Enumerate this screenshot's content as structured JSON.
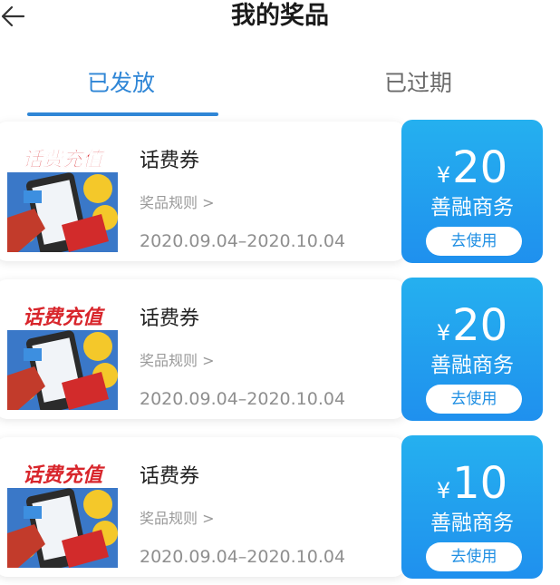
{
  "header": {
    "title": "我的奖品",
    "back_icon": "arrow-left-icon"
  },
  "tabs": [
    {
      "label": "已发放",
      "active": true
    },
    {
      "label": "已过期",
      "active": false
    }
  ],
  "colors": {
    "accent": "#2f86d6",
    "coupon_blue": "#1f90ee",
    "coupon_blue_light": "#25b0ef"
  },
  "coupons": [
    {
      "image_text": "话费充值",
      "name": "话费券",
      "rules_link": "奖品规则 >",
      "dates": "2020.09.04–2020.10.04",
      "currency": "¥",
      "amount": "20",
      "merchant": "善融商务",
      "button": "去使用"
    },
    {
      "image_text": "话费充值",
      "name": "话费券",
      "rules_link": "奖品规则 >",
      "dates": "2020.09.04–2020.10.04",
      "currency": "¥",
      "amount": "20",
      "merchant": "善融商务",
      "button": "去使用"
    },
    {
      "image_text": "话费充值",
      "name": "话费券",
      "rules_link": "奖品规则 >",
      "dates": "2020.09.04–2020.10.04",
      "currency": "¥",
      "amount": "10",
      "merchant": "善融商务",
      "button": "去使用"
    }
  ]
}
